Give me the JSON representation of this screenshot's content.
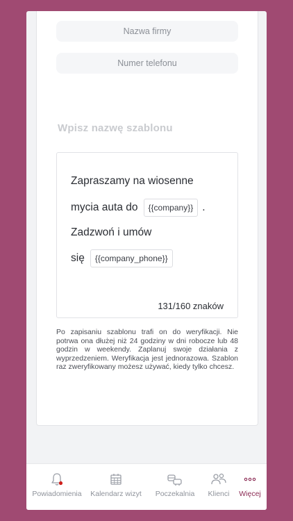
{
  "form": {
    "company_name_placeholder": "Nazwa firmy",
    "phone_placeholder": "Numer telefonu",
    "template_name_placeholder": "Wpisz nazwę szablonu"
  },
  "editor": {
    "line1": "Zapraszamy na wiosenne",
    "line2_text": "mycia auta do",
    "line2_chip": "{{company}}",
    "line2_suffix": ".",
    "line3": "Zadzwoń i umów",
    "line4_text": "się",
    "line4_chip": "{{company_phone}}",
    "counter": "131/160 znaków"
  },
  "info_text": "Po zapisaniu szablonu trafi on do weryfikacji. Nie potrwa ona dłużej niż 24 godziny w dni robocze lub 48 godzin w weekendy. Zaplanuj swoje działania z wyprzedzeniem. Weryfikacja jest jednorazowa. Szablon raz zweryfikowany możesz używać, kiedy tylko chcesz.",
  "tabbar": {
    "items": [
      {
        "label": "Powiadomienia",
        "icon": "bell-icon"
      },
      {
        "label": "Kalendarz wizyt",
        "icon": "calendar-icon"
      },
      {
        "label": "Poczekalnia",
        "icon": "waiting-room-icon"
      },
      {
        "label": "Klienci",
        "icon": "clients-icon"
      },
      {
        "label": "Więcej",
        "icon": "more-icon"
      }
    ]
  },
  "colors": {
    "background": "#a04a72",
    "accent": "#8c2c55",
    "notification_dot": "#d0201c",
    "inactive": "#8e929a"
  }
}
